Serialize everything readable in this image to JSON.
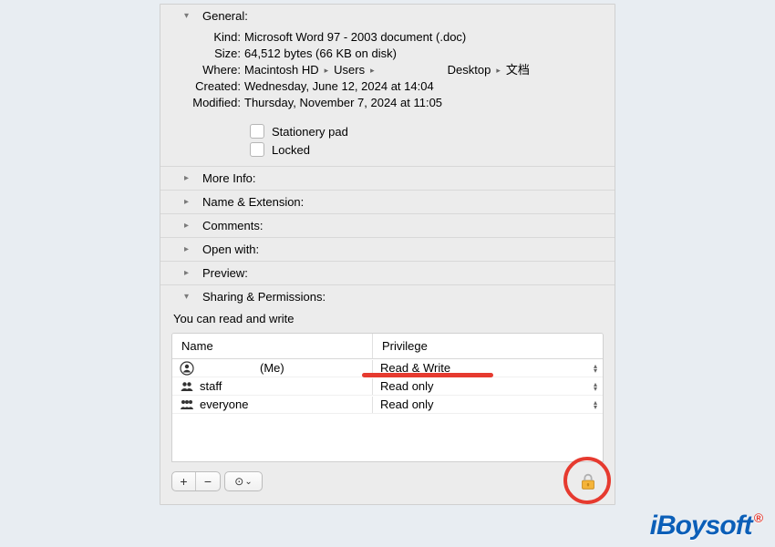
{
  "general": {
    "header": "General:",
    "kind_label": "Kind:",
    "kind": "Microsoft Word 97 - 2003 document (.doc)",
    "size_label": "Size:",
    "size": "64,512 bytes (66 KB on disk)",
    "where_label": "Where:",
    "where_parts": [
      "Macintosh HD",
      "Users",
      "",
      "Desktop",
      "文档"
    ],
    "created_label": "Created:",
    "created": "Wednesday, June 12, 2024 at 14:04",
    "modified_label": "Modified:",
    "modified": "Thursday, November 7, 2024 at 11:05",
    "stationery": "Stationery pad",
    "locked": "Locked"
  },
  "sections": {
    "more_info": "More Info:",
    "name_ext": "Name & Extension:",
    "comments": "Comments:",
    "open_with": "Open with:",
    "preview": "Preview:"
  },
  "sharing": {
    "header": "Sharing & Permissions:",
    "note": "You can read and write",
    "col_name": "Name",
    "col_priv": "Privilege",
    "rows": [
      {
        "icon": "person",
        "name": "",
        "suffix": "(Me)",
        "priv": "Read & Write"
      },
      {
        "icon": "group",
        "name": "staff",
        "suffix": "",
        "priv": "Read only"
      },
      {
        "icon": "group3",
        "name": "everyone",
        "suffix": "",
        "priv": "Read only"
      }
    ],
    "add": "+",
    "remove": "−",
    "action": "⊙",
    "action_chev": "⌄"
  },
  "watermark": "iBoysoft"
}
